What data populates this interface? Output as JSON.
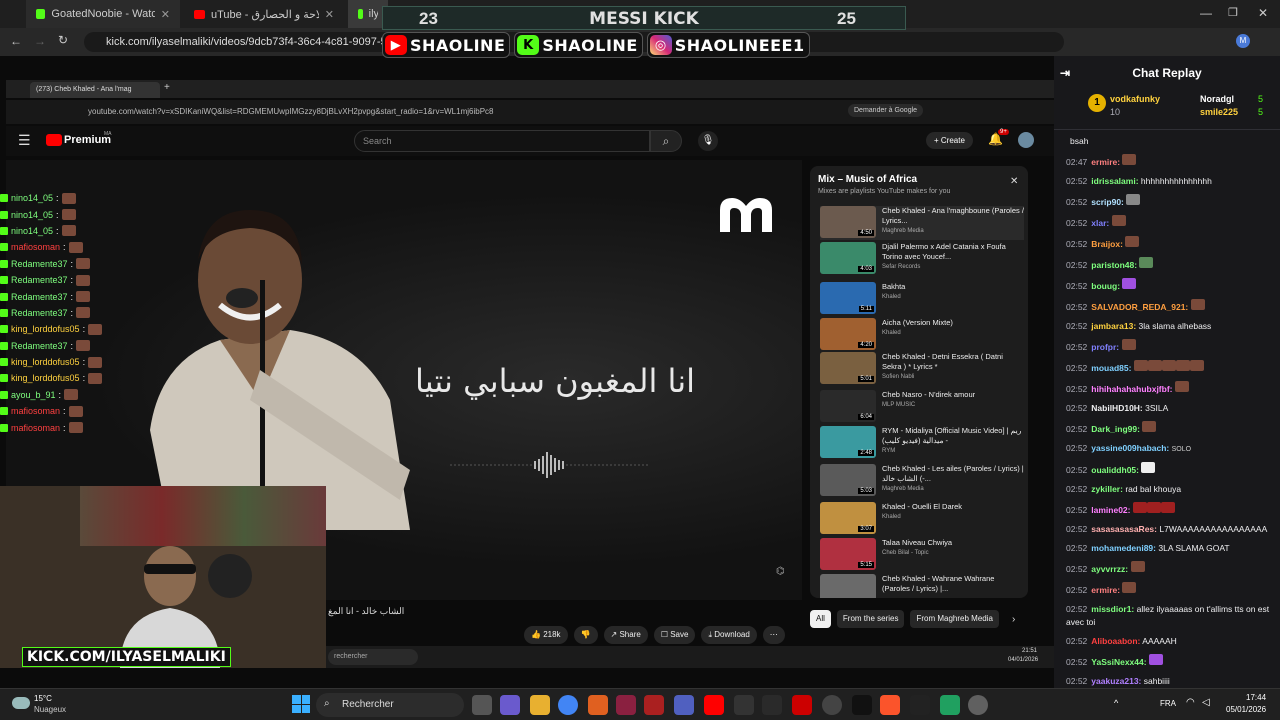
{
  "outer_tabs": [
    {
      "label": "GoatedNoobie - Watch the VO",
      "color": "#53fc18"
    },
    {
      "label": "uTube - منتخب الفلاحة و الحصارق",
      "color": "#ff0000"
    },
    {
      "label": "ilyaselm",
      "color": "#53fc18"
    }
  ],
  "outer_url": "kick.com/ilyaselmaliki/videos/9dcb73f4-36c4-4c81-9097-564765fa",
  "overlay": {
    "score_left": "23",
    "title": "MESSI KICK",
    "score_right": "25",
    "socials": [
      {
        "label": "SHAOLINE",
        "icon": "youtube-icon",
        "color": "#ff0000"
      },
      {
        "label": "SHAOLINE",
        "icon": "kick-icon",
        "color": "#53fc18"
      },
      {
        "label": "SHAOLINEEE1",
        "icon": "instagram-icon",
        "color": "#d62976"
      }
    ],
    "kick_url": "KICK.COM/ILYASELMALIKI"
  },
  "inner_browser": {
    "tab": "(273) Cheb Khaled - Ana l'mag",
    "url": "youtube.com/watch?v=xSDIKaniWQ&list=RDGMEMUwpIMGzzy8DjBLvXH2pvpg&start_radio=1&rv=WL1mj6ibPc8",
    "ask_google": "Demander à Google"
  },
  "youtube": {
    "brand": "Premium",
    "brand_sup": "MA",
    "search_placeholder": "Search",
    "create": "Create",
    "notif_count": "9+",
    "lyric": "انا المغبون سبابي نتيا",
    "video_title": "الشاب خالد - انا المغ",
    "actions": {
      "likes": "218k",
      "share": "Share",
      "save": "Save",
      "download": "Download"
    },
    "taskbar_search": "rechercher",
    "taskbar_time": "21:51",
    "taskbar_date": "04/01/2026"
  },
  "playlist": {
    "title": "Mix – Music of Africa",
    "subtitle": "Mixes are playlists YouTube makes for you",
    "items": [
      {
        "title": "Cheb Khaled - Ana l'maghboune (Paroles / Lyrics...",
        "channel": "Maghreb Media",
        "dur": "4:50",
        "color": "#6b5a4e"
      },
      {
        "title": "Djalil Palermo x Adel Catania x Foufa Torino avec Youcef...",
        "channel": "Sefar Records",
        "dur": "4:03",
        "color": "#3a8a6a"
      },
      {
        "title": "Bakhta",
        "channel": "Khaled",
        "dur": "5:11",
        "color": "#2a6ab0"
      },
      {
        "title": "Aicha (Version Mixte)",
        "channel": "Khaled",
        "dur": "4:20",
        "color": "#a06030"
      },
      {
        "title": "Cheb Khaled - Detni Essekra ( Datni Sekra ) * Lyrics *",
        "channel": "Sofien Nabli",
        "dur": "5:01",
        "color": "#7a6040"
      },
      {
        "title": "Cheb Nasro - N'direk amour",
        "channel": "MLP MUSIC",
        "dur": "6:04",
        "color": "#2a2a2a"
      },
      {
        "title": "RYM - Midaliya [Official Music Video] | ريم - ميدالية (فيديو كليب)",
        "channel": "RYM",
        "dur": "2:48",
        "color": "#3a9aa0"
      },
      {
        "title": "Cheb Khaled - Les ailes (Paroles / Lyrics) | الشاب خالد (-...",
        "channel": "Maghreb Media",
        "dur": "5:03",
        "color": "#5a5a5a"
      },
      {
        "title": "Khaled - Ouelli El Darek",
        "channel": "Khaled",
        "dur": "3:07",
        "color": "#c09040"
      },
      {
        "title": "Talaa Niveau Chwiya",
        "channel": "Cheb Bilal - Topic",
        "dur": "5:15",
        "color": "#b03040"
      },
      {
        "title": "Cheb Khaled - Wahrane Wahrane (Paroles / Lyrics) |...",
        "channel": "",
        "dur": "",
        "color": "#6a6a6a"
      }
    ],
    "chips": [
      "All",
      "From the series",
      "From Maghreb Media"
    ]
  },
  "left_chat": [
    {
      "user": "nino14_05",
      "color": "#7fff7f"
    },
    {
      "user": "nino14_05",
      "color": "#7fff7f"
    },
    {
      "user": "nino14_05",
      "color": "#7fff7f"
    },
    {
      "user": "mafiosoman",
      "color": "#ff4040"
    },
    {
      "user": "Redamente37",
      "color": "#7fff7f"
    },
    {
      "user": "Redamente37",
      "color": "#7fff7f"
    },
    {
      "user": "Redamente37",
      "color": "#7fff7f"
    },
    {
      "user": "Redamente37",
      "color": "#7fff7f"
    },
    {
      "user": "king_lorddofus05",
      "color": "#ffd23f"
    },
    {
      "user": "Redamente37",
      "color": "#7fff7f"
    },
    {
      "user": "king_lorddofus05",
      "color": "#ffd23f"
    },
    {
      "user": "king_lorddofus05",
      "color": "#ffd23f"
    },
    {
      "user": "ayou_b_91",
      "color": "#7fff7f"
    },
    {
      "user": "mafiosoman",
      "color": "#ff4040"
    },
    {
      "user": "mafiosoman",
      "color": "#ff4040"
    }
  ],
  "chat_replay": {
    "title": "Chat Replay",
    "leaders": [
      {
        "name": "vodkafunky",
        "count": "10"
      },
      {
        "name": "Noradgl",
        "count": "5"
      },
      {
        "name": "smile225",
        "count": "5"
      }
    ],
    "messages": [
      {
        "time": "",
        "user": "",
        "text": "bsah",
        "color": "#efeff1"
      },
      {
        "time": "02:47",
        "user": "ermire:",
        "text": "",
        "color": "#ff8080"
      },
      {
        "time": "02:52",
        "user": "idrissalami:",
        "text": "hhhhhhhhhhhhhhh",
        "color": "#7fff7f"
      },
      {
        "time": "02:52",
        "user": "scrip90:",
        "text": "",
        "color": "#b0e0ff"
      },
      {
        "time": "02:52",
        "user": "xlar:",
        "text": "",
        "color": "#8080ff"
      },
      {
        "time": "02:52",
        "user": "Braijox:",
        "text": "",
        "color": "#ff9f40"
      },
      {
        "time": "02:52",
        "user": "pariston48:",
        "text": "",
        "color": "#7fff7f"
      },
      {
        "time": "02:52",
        "user": "bouug:",
        "text": "",
        "color": "#7fff7f"
      },
      {
        "time": "02:52",
        "user": "SALVADOR_REDA_921:",
        "text": "",
        "color": "#ff9f40"
      },
      {
        "time": "02:52",
        "user": "jambara13:",
        "text": "3la slama alhebass",
        "color": "#ffd23f"
      },
      {
        "time": "02:52",
        "user": "profpr:",
        "text": "",
        "color": "#8080ff"
      },
      {
        "time": "02:52",
        "user": "mouad85:",
        "text": "",
        "color": "#7fd0ff"
      },
      {
        "time": "02:52",
        "user": "hihihahahahubxjfbf:",
        "text": "",
        "color": "#ff80ff"
      },
      {
        "time": "02:52",
        "user": "NabilHD10H:",
        "text": "3SILA",
        "color": "#efeff1"
      },
      {
        "time": "02:52",
        "user": "Dark_ing99:",
        "text": "",
        "color": "#7fff7f"
      },
      {
        "time": "02:52",
        "user": "yassine009habach:",
        "text": "SOLO",
        "color": "#7fd0ff"
      },
      {
        "time": "02:52",
        "user": "oualiddh05:",
        "text": "",
        "color": "#7fff7f"
      },
      {
        "time": "02:52",
        "user": "zykiller:",
        "text": "rad bal khouya",
        "color": "#7fff7f"
      },
      {
        "time": "02:52",
        "user": "lamine02:",
        "text": "",
        "color": "#ff80ff"
      },
      {
        "time": "02:52",
        "user": "sasasasasaRes:",
        "text": "L7WAAAAAAAAAAAAAAAA",
        "color": "#ffb0b0"
      },
      {
        "time": "02:52",
        "user": "mohamedeni89:",
        "text": "3LA SLAMA GOAT",
        "color": "#7fd0ff"
      },
      {
        "time": "02:52",
        "user": "ayvvrrzz:",
        "text": "",
        "color": "#7fff7f"
      },
      {
        "time": "02:52",
        "user": "ermire:",
        "text": "",
        "color": "#ff8080"
      },
      {
        "time": "02:52",
        "user": "missdior1:",
        "text": "allez ilyaaaaas on t'allims tts on est avec toi",
        "color": "#7fff7f"
      },
      {
        "time": "02:52",
        "user": "Aliboaabon:",
        "text": "AAAAAH",
        "color": "#ff4040"
      },
      {
        "time": "02:52",
        "user": "YaSsiNexx44:",
        "text": "",
        "color": "#7fff7f"
      },
      {
        "time": "02:52",
        "user": "yaakuza213:",
        "text": "sahbiiii",
        "color": "#b080ff"
      }
    ]
  },
  "taskbar": {
    "weather_temp": "15°C",
    "weather_desc": "Nuageux",
    "search": "Rechercher",
    "lang": "FRA",
    "time": "17:44",
    "date": "05/01/2026"
  }
}
